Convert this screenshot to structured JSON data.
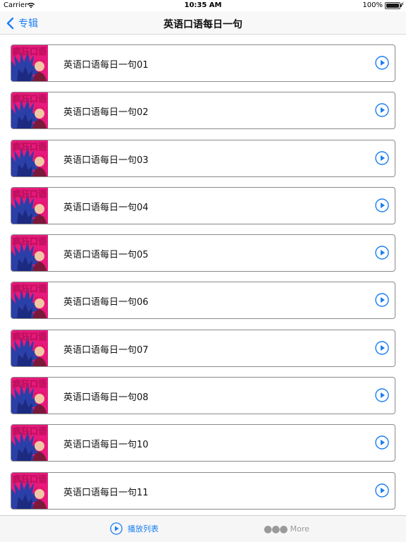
{
  "status_bar": {
    "carrier": "Carrier",
    "time": "10:35 AM",
    "battery": "100%"
  },
  "nav": {
    "back_label": "专辑",
    "title": "英语口语每日一句"
  },
  "thumbnail_text": "疯狂口语",
  "items": [
    {
      "title": "英语口语每日一句01"
    },
    {
      "title": "英语口语每日一句02"
    },
    {
      "title": "英语口语每日一句03"
    },
    {
      "title": "英语口语每日一句04"
    },
    {
      "title": "英语口语每日一句05"
    },
    {
      "title": "英语口语每日一句06"
    },
    {
      "title": "英语口语每日一句07"
    },
    {
      "title": "英语口语每日一句08"
    },
    {
      "title": "英语口语每日一句10"
    },
    {
      "title": "英语口语每日一句11"
    }
  ],
  "tab_bar": {
    "play_list": "播放列表",
    "more": "More"
  },
  "colors": {
    "accent": "#1a7ef2",
    "thumb_pink": "#e8197c",
    "thumb_blue": "#2b3fa8"
  },
  "icons": [
    "wifi-icon",
    "battery-icon",
    "back-chevron-icon",
    "play-circle-icon",
    "more-dots-icon"
  ]
}
